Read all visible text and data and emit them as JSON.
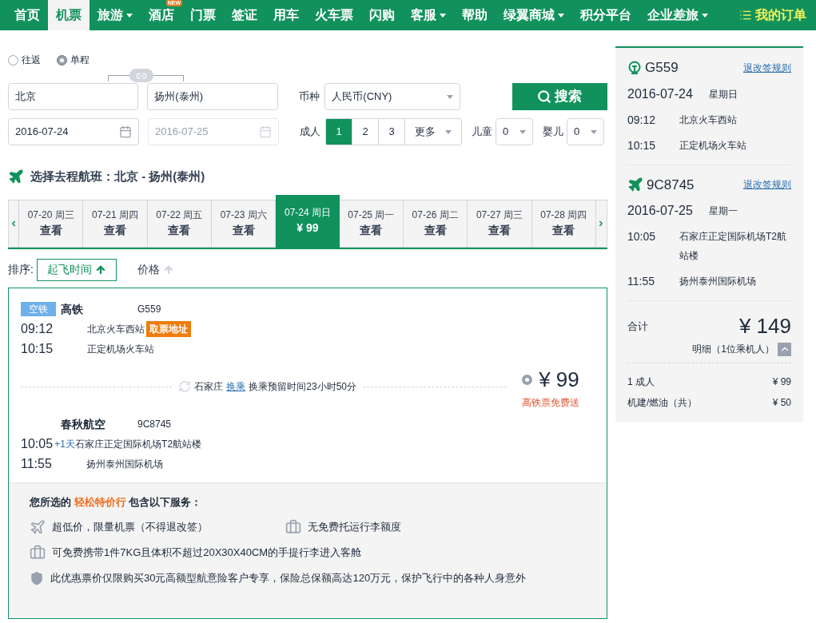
{
  "nav": {
    "items": [
      {
        "label": "首页",
        "selected": false,
        "dropdown": false
      },
      {
        "label": "机票",
        "selected": true,
        "dropdown": false
      },
      {
        "label": "旅游",
        "selected": false,
        "dropdown": true
      },
      {
        "label": "酒店",
        "selected": false,
        "dropdown": false,
        "badge": "NEW"
      },
      {
        "label": "门票",
        "selected": false,
        "dropdown": false
      },
      {
        "label": "签证",
        "selected": false,
        "dropdown": false
      },
      {
        "label": "用车",
        "selected": false,
        "dropdown": false
      },
      {
        "label": "火车票",
        "selected": false,
        "dropdown": false
      },
      {
        "label": "闪购",
        "selected": false,
        "dropdown": false
      },
      {
        "label": "客服",
        "selected": false,
        "dropdown": true
      },
      {
        "label": "帮助",
        "selected": false,
        "dropdown": false
      },
      {
        "label": "绿翼商城",
        "selected": false,
        "dropdown": true
      },
      {
        "label": "积分平台",
        "selected": false,
        "dropdown": false
      },
      {
        "label": "企业差旅",
        "selected": false,
        "dropdown": true
      }
    ],
    "orders": "我的订单"
  },
  "trip_types": [
    {
      "label": "往返",
      "selected": false
    },
    {
      "label": "单程",
      "selected": true
    }
  ],
  "search": {
    "from": "北京",
    "to": "扬州(泰州)",
    "depart_date": "2016-07-24",
    "return_date": "2016-07-25",
    "return_disabled": true,
    "currency_label": "币种",
    "currency": "人民币(CNY)",
    "button": "搜索",
    "adults_label": "成人",
    "adults": [
      {
        "label": "1",
        "selected": true
      },
      {
        "label": "2",
        "selected": false
      },
      {
        "label": "3",
        "selected": false
      }
    ],
    "more": "更多",
    "children_label": "儿童",
    "children": "0",
    "infants_label": "婴儿",
    "infants": "0"
  },
  "heading": "选择去程航班：北京 - 扬州(泰州)",
  "dates": [
    {
      "date": "07-20 周三",
      "price": "查看",
      "selected": false
    },
    {
      "date": "07-21 周四",
      "price": "查看",
      "selected": false
    },
    {
      "date": "07-22 周五",
      "price": "查看",
      "selected": false
    },
    {
      "date": "07-23 周六",
      "price": "查看",
      "selected": false
    },
    {
      "date": "07-24 周日",
      "price": "¥ 99",
      "selected": true
    },
    {
      "date": "07-25 周一",
      "price": "查看",
      "selected": false
    },
    {
      "date": "07-26 周二",
      "price": "查看",
      "selected": false
    },
    {
      "date": "07-27 周三",
      "price": "查看",
      "selected": false
    },
    {
      "date": "07-28 周四",
      "price": "查看",
      "selected": false
    }
  ],
  "sort": {
    "label": "排序:",
    "options": [
      {
        "label": "起飞时间",
        "selected": true
      },
      {
        "label": "价格",
        "selected": false
      }
    ]
  },
  "result": {
    "tag": "空铁",
    "legs": [
      {
        "carrier": "高铁",
        "number": "G559",
        "stops": [
          {
            "time": "09:12",
            "place": "北京火车西站",
            "badge": "取票地址"
          },
          {
            "time": "10:15",
            "place": "正定机场火车站"
          }
        ]
      },
      {
        "carrier": "春秋航空",
        "number": "9C8745",
        "stops": [
          {
            "time": "10:05",
            "extra": "+1天",
            "place": "石家庄正定国际机场T2航站楼"
          },
          {
            "time": "11:55",
            "place": "扬州泰州国际机场"
          }
        ]
      }
    ],
    "transfer": {
      "city": "石家庄",
      "link": "换乘",
      "note": "换乘预留时间23小时50分"
    },
    "price": "¥ 99",
    "price_note": "高铁票免费送",
    "services": {
      "intro": "您所选的 **轻松特价行** 包含以下服务：",
      "items": [
        {
          "kind": "plane",
          "text": "超低价，限量机票（不得退改签）"
        },
        {
          "kind": "bag",
          "text": "无免费托运行李额度"
        },
        {
          "kind": "bag",
          "text": "可免费携带1件7KG且体积不超过20X30X40CM的手提行李进入客舱"
        },
        {
          "kind": "shield",
          "text": "此优惠票价仅限购买30元高额型航意险客户专享，保险总保额高达120万元，保护飞行中的各种人身意外"
        }
      ]
    }
  },
  "summary": {
    "segments": [
      {
        "kind": "train",
        "number": "G559",
        "rules": "退改签规则",
        "date": "2016-07-24",
        "weekday": "星期日",
        "stops": [
          {
            "time": "09:12",
            "place": "北京火车西站"
          },
          {
            "time": "10:15",
            "place": "正定机场火车站"
          }
        ]
      },
      {
        "kind": "plane",
        "number": "9C8745",
        "rules": "退改签规则",
        "date": "2016-07-25",
        "weekday": "星期一",
        "stops": [
          {
            "time": "10:05",
            "place": "石家庄正定国际机场T2航站楼"
          },
          {
            "time": "11:55",
            "place": "扬州泰州国际机场"
          }
        ]
      }
    ],
    "total_label": "合计",
    "total": "¥ 149",
    "detail": "明细（1位乘机人）",
    "lines": [
      {
        "label": "1 成人",
        "value": "¥ 99"
      },
      {
        "label": "机建/燃油（共）",
        "value": "¥ 50"
      }
    ]
  }
}
